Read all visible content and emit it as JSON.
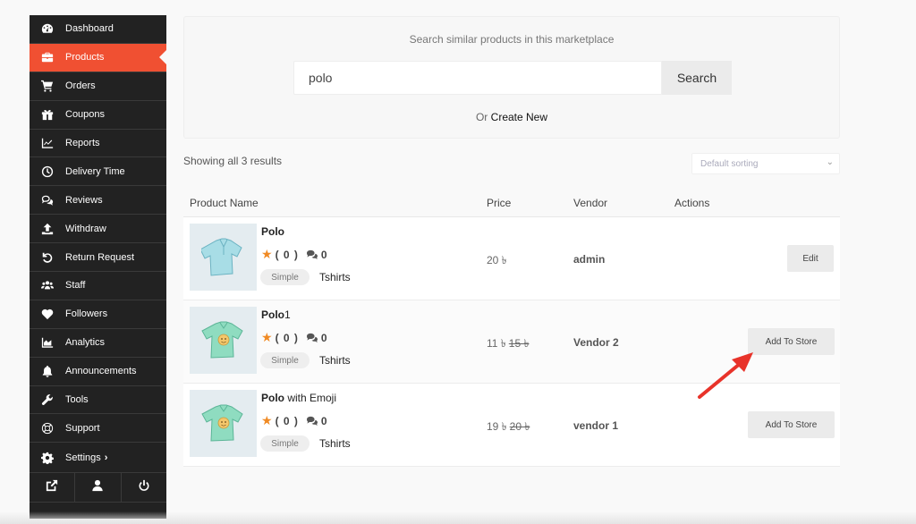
{
  "sidebar": {
    "items": [
      {
        "label": "Dashboard",
        "icon": "dashboard-icon",
        "active": false
      },
      {
        "label": "Products",
        "icon": "briefcase-icon",
        "active": true
      },
      {
        "label": "Orders",
        "icon": "cart-icon",
        "active": false
      },
      {
        "label": "Coupons",
        "icon": "gift-icon",
        "active": false
      },
      {
        "label": "Reports",
        "icon": "chart-line-icon",
        "active": false
      },
      {
        "label": "Delivery Time",
        "icon": "clock-icon",
        "active": false
      },
      {
        "label": "Reviews",
        "icon": "comments-icon",
        "active": false
      },
      {
        "label": "Withdraw",
        "icon": "upload-icon",
        "active": false
      },
      {
        "label": "Return Request",
        "icon": "undo-icon",
        "active": false
      },
      {
        "label": "Staff",
        "icon": "users-icon",
        "active": false
      },
      {
        "label": "Followers",
        "icon": "heart-icon",
        "active": false
      },
      {
        "label": "Analytics",
        "icon": "area-chart-icon",
        "active": false
      },
      {
        "label": "Announcements",
        "icon": "bell-icon",
        "active": false
      },
      {
        "label": "Tools",
        "icon": "wrench-icon",
        "active": false
      },
      {
        "label": "Support",
        "icon": "lifebuoy-icon",
        "active": false
      },
      {
        "label": "Settings",
        "icon": "gear-icon",
        "active": false,
        "chevron": "›"
      }
    ],
    "footer": [
      "external-link-icon",
      "user-icon",
      "power-icon"
    ]
  },
  "search": {
    "title": "Search similar products in this marketplace",
    "value": "polo",
    "button": "Search",
    "or_text": "Or",
    "create_link": "Create New"
  },
  "results": {
    "count_text": "Showing all 3 results",
    "sort_selected": "Default sorting"
  },
  "table": {
    "headers": {
      "name": "Product Name",
      "price": "Price",
      "vendor": "Vendor",
      "actions": "Actions"
    },
    "rows": [
      {
        "name_bold": "Polo",
        "name_rest": "",
        "rating": "( 0 )",
        "comments": "0",
        "type": "Simple",
        "category": "Tshirts",
        "price": "20 ৳",
        "old_price": "",
        "vendor": "admin",
        "action": "Edit",
        "image": "polo-shirt"
      },
      {
        "name_bold": "Polo",
        "name_rest": "1",
        "rating": "( 0 )",
        "comments": "0",
        "type": "Simple",
        "category": "Tshirts",
        "price": "11 ৳",
        "old_price": "15 ৳",
        "vendor": "Vendor 2",
        "action": "Add To Store",
        "image": "emoji-tshirt"
      },
      {
        "name_bold": "Polo",
        "name_rest": " with Emoji",
        "rating": "( 0 )",
        "comments": "0",
        "type": "Simple",
        "category": "Tshirts",
        "price": "19 ৳",
        "old_price": "20 ৳",
        "vendor": "vendor 1",
        "action": "Add To Store",
        "image": "emoji-tshirt"
      }
    ]
  },
  "colors": {
    "sidebar_bg": "#222222",
    "accent": "#f05032",
    "star": "#f08a24",
    "annotation_arrow": "#e8332a"
  }
}
